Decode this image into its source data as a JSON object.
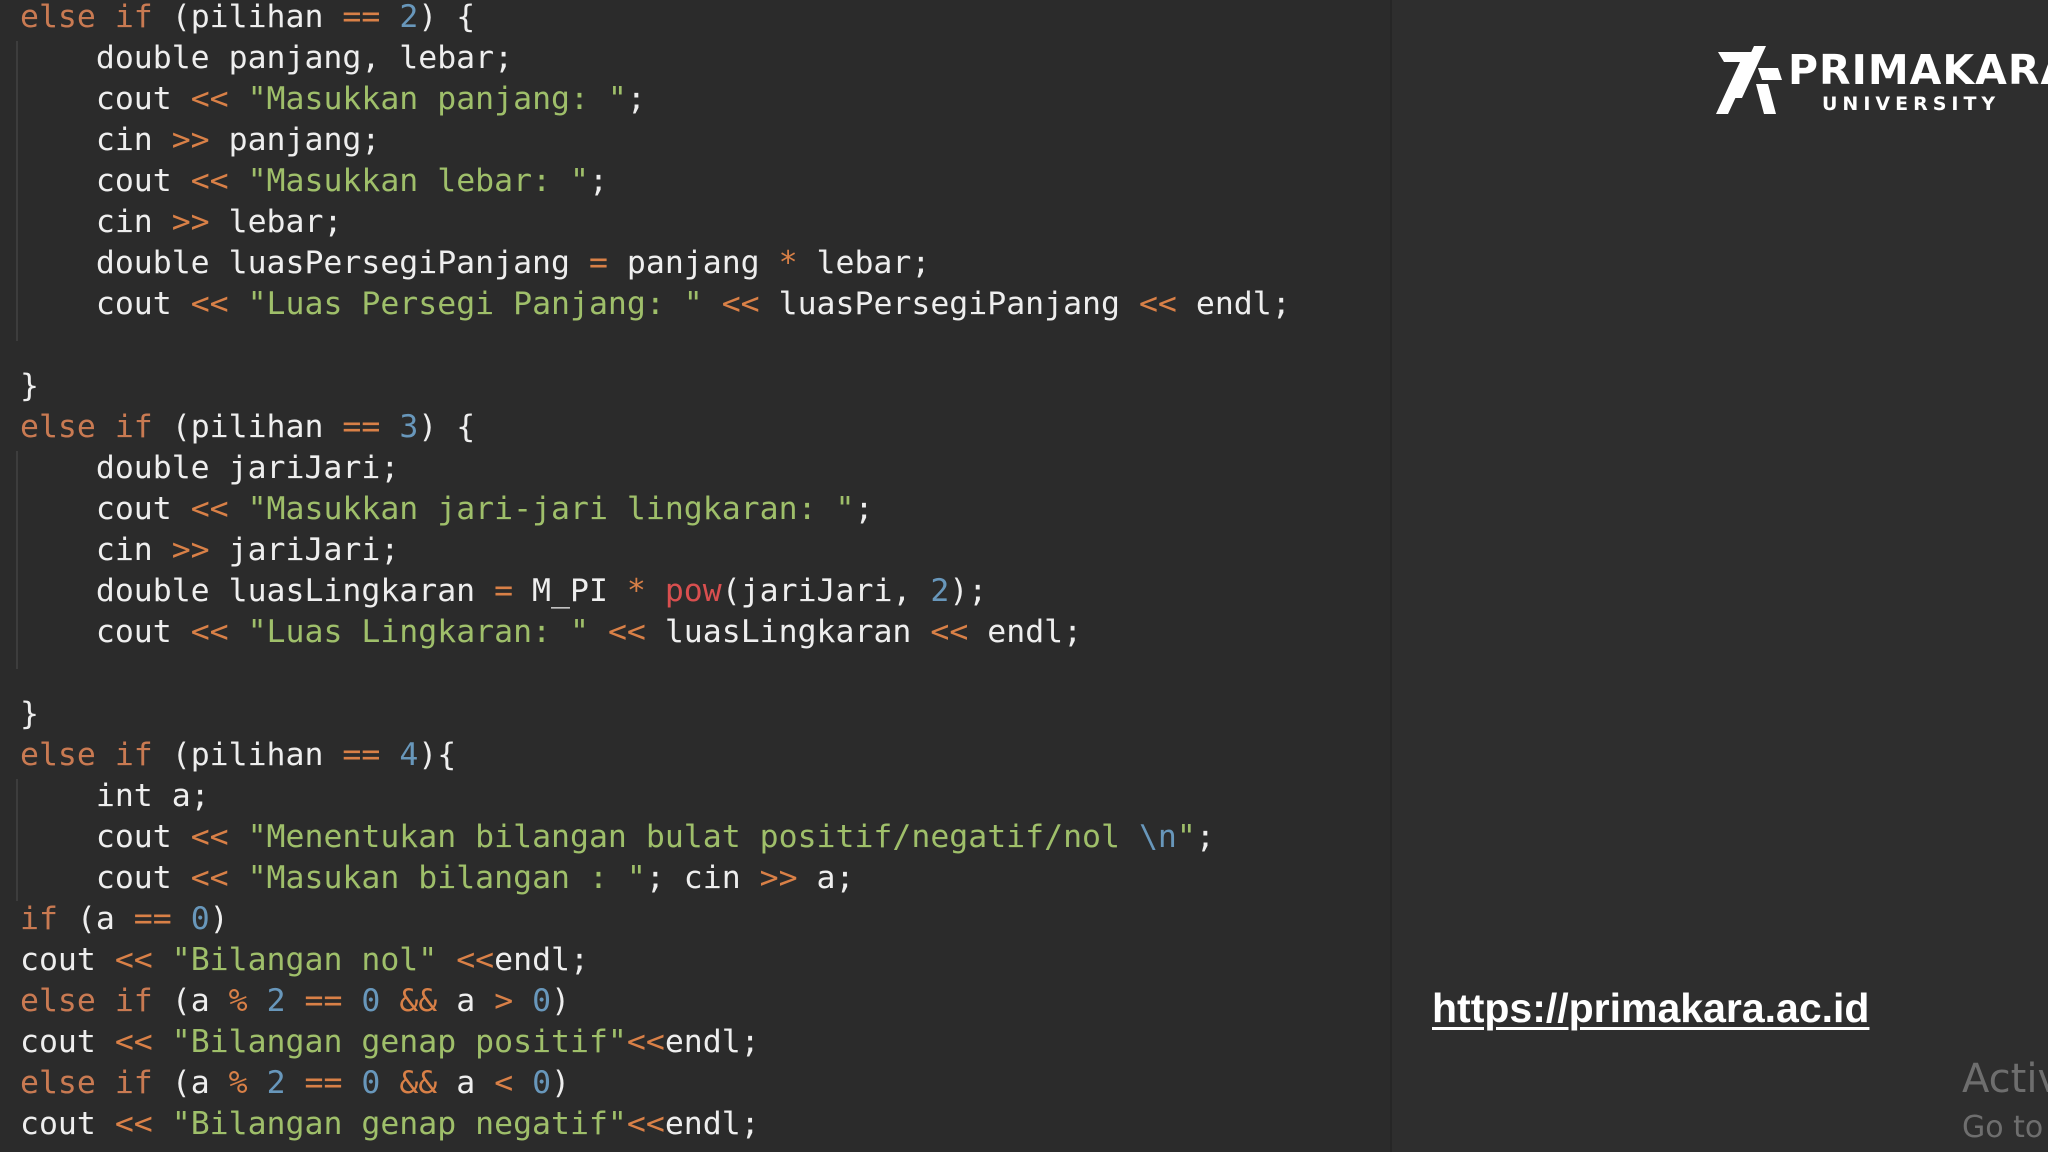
{
  "code": {
    "lines": [
      [
        [
          "kw",
          "else if"
        ],
        [
          "pl",
          " (pilihan "
        ],
        [
          "op",
          "=="
        ],
        [
          "pl",
          " "
        ],
        [
          "num",
          "2"
        ],
        [
          "pl",
          ") {"
        ]
      ],
      [
        [
          "pl",
          "    double panjang, lebar;"
        ]
      ],
      [
        [
          "pl",
          "    cout "
        ],
        [
          "op",
          "<<"
        ],
        [
          "pl",
          " "
        ],
        [
          "str",
          "\"Masukkan panjang: \""
        ],
        [
          "pl",
          ";"
        ]
      ],
      [
        [
          "pl",
          "    cin "
        ],
        [
          "op",
          ">>"
        ],
        [
          "pl",
          " panjang;"
        ]
      ],
      [
        [
          "pl",
          "    cout "
        ],
        [
          "op",
          "<<"
        ],
        [
          "pl",
          " "
        ],
        [
          "str",
          "\"Masukkan lebar: \""
        ],
        [
          "pl",
          ";"
        ]
      ],
      [
        [
          "pl",
          "    cin "
        ],
        [
          "op",
          ">>"
        ],
        [
          "pl",
          " lebar;"
        ]
      ],
      [
        [
          "pl",
          "    double luasPersegiPanjang "
        ],
        [
          "op",
          "="
        ],
        [
          "pl",
          " panjang "
        ],
        [
          "op",
          "*"
        ],
        [
          "pl",
          " lebar;"
        ]
      ],
      [
        [
          "pl",
          "    cout "
        ],
        [
          "op",
          "<<"
        ],
        [
          "pl",
          " "
        ],
        [
          "str",
          "\"Luas Persegi Panjang: \""
        ],
        [
          "pl",
          " "
        ],
        [
          "op",
          "<<"
        ],
        [
          "pl",
          " luasPersegiPanjang "
        ],
        [
          "op",
          "<<"
        ],
        [
          "pl",
          " endl;"
        ]
      ],
      [],
      [
        [
          "pl",
          "}"
        ]
      ],
      [
        [
          "kw",
          "else if"
        ],
        [
          "pl",
          " (pilihan "
        ],
        [
          "op",
          "=="
        ],
        [
          "pl",
          " "
        ],
        [
          "num",
          "3"
        ],
        [
          "pl",
          ") {"
        ]
      ],
      [
        [
          "pl",
          "    double jariJari;"
        ]
      ],
      [
        [
          "pl",
          "    cout "
        ],
        [
          "op",
          "<<"
        ],
        [
          "pl",
          " "
        ],
        [
          "str",
          "\"Masukkan jari-jari lingkaran: \""
        ],
        [
          "pl",
          ";"
        ]
      ],
      [
        [
          "pl",
          "    cin "
        ],
        [
          "op",
          ">>"
        ],
        [
          "pl",
          " jariJari;"
        ]
      ],
      [
        [
          "pl",
          "    double luasLingkaran "
        ],
        [
          "op",
          "="
        ],
        [
          "pl",
          " M_PI "
        ],
        [
          "op",
          "*"
        ],
        [
          "pl",
          " "
        ],
        [
          "fn",
          "pow"
        ],
        [
          "pl",
          "(jariJari, "
        ],
        [
          "num",
          "2"
        ],
        [
          "pl",
          ");"
        ]
      ],
      [
        [
          "pl",
          "    cout "
        ],
        [
          "op",
          "<<"
        ],
        [
          "pl",
          " "
        ],
        [
          "str",
          "\"Luas Lingkaran: \""
        ],
        [
          "pl",
          " "
        ],
        [
          "op",
          "<<"
        ],
        [
          "pl",
          " luasLingkaran "
        ],
        [
          "op",
          "<<"
        ],
        [
          "pl",
          " endl;"
        ]
      ],
      [],
      [
        [
          "pl",
          "}"
        ]
      ],
      [
        [
          "kw",
          "else if"
        ],
        [
          "pl",
          " (pilihan "
        ],
        [
          "op",
          "=="
        ],
        [
          "pl",
          " "
        ],
        [
          "num",
          "4"
        ],
        [
          "pl",
          "){"
        ]
      ],
      [
        [
          "pl",
          "    int a;"
        ]
      ],
      [
        [
          "pl",
          "    cout "
        ],
        [
          "op",
          "<<"
        ],
        [
          "pl",
          " "
        ],
        [
          "str",
          "\"Menentukan bilangan bulat positif/negatif/nol "
        ],
        [
          "num",
          "\\n"
        ],
        [
          "str",
          "\""
        ],
        [
          "pl",
          ";"
        ]
      ],
      [
        [
          "pl",
          "    cout "
        ],
        [
          "op",
          "<<"
        ],
        [
          "pl",
          " "
        ],
        [
          "str",
          "\"Masukan bilangan : \""
        ],
        [
          "pl",
          "; cin "
        ],
        [
          "op",
          ">>"
        ],
        [
          "pl",
          " a;"
        ]
      ],
      [
        [
          "kw",
          "if"
        ],
        [
          "pl",
          " (a "
        ],
        [
          "op",
          "=="
        ],
        [
          "pl",
          " "
        ],
        [
          "num",
          "0"
        ],
        [
          "pl",
          ")"
        ]
      ],
      [
        [
          "pl",
          "cout "
        ],
        [
          "op",
          "<<"
        ],
        [
          "pl",
          " "
        ],
        [
          "str",
          "\"Bilangan nol\""
        ],
        [
          "pl",
          " "
        ],
        [
          "op",
          "<<"
        ],
        [
          "pl",
          "endl;"
        ]
      ],
      [
        [
          "kw",
          "else if"
        ],
        [
          "pl",
          " (a "
        ],
        [
          "op",
          "%"
        ],
        [
          "pl",
          " "
        ],
        [
          "num",
          "2"
        ],
        [
          "pl",
          " "
        ],
        [
          "op",
          "=="
        ],
        [
          "pl",
          " "
        ],
        [
          "num",
          "0"
        ],
        [
          "pl",
          " "
        ],
        [
          "op",
          "&&"
        ],
        [
          "pl",
          " a "
        ],
        [
          "op",
          ">"
        ],
        [
          "pl",
          " "
        ],
        [
          "num",
          "0"
        ],
        [
          "pl",
          ")"
        ]
      ],
      [
        [
          "pl",
          "cout "
        ],
        [
          "op",
          "<<"
        ],
        [
          "pl",
          " "
        ],
        [
          "str",
          "\"Bilangan genap positif\""
        ],
        [
          "op",
          "<<"
        ],
        [
          "pl",
          "endl;"
        ]
      ],
      [
        [
          "kw",
          "else if"
        ],
        [
          "pl",
          " (a "
        ],
        [
          "op",
          "%"
        ],
        [
          "pl",
          " "
        ],
        [
          "num",
          "2"
        ],
        [
          "pl",
          " "
        ],
        [
          "op",
          "=="
        ],
        [
          "pl",
          " "
        ],
        [
          "num",
          "0"
        ],
        [
          "pl",
          " "
        ],
        [
          "op",
          "&&"
        ],
        [
          "pl",
          " a "
        ],
        [
          "op",
          "<"
        ],
        [
          "pl",
          " "
        ],
        [
          "num",
          "0"
        ],
        [
          "pl",
          ")"
        ]
      ],
      [
        [
          "pl",
          "cout "
        ],
        [
          "op",
          "<<"
        ],
        [
          "pl",
          " "
        ],
        [
          "str",
          "\"Bilangan genap negatif\""
        ],
        [
          "op",
          "<<"
        ],
        [
          "pl",
          "endl;"
        ]
      ]
    ]
  },
  "logo": {
    "name": "PRIMAKARA",
    "subtitle": "UNIVERSITY"
  },
  "link": {
    "url_text": "https://primakara.ac.id"
  },
  "watermark": {
    "line1": "Activ",
    "line2": "Go to"
  },
  "colors": {
    "background": "#2b2b2b",
    "keyword": "#c97a52",
    "operator": "#d98047",
    "string": "#9fbf6a",
    "number": "#6897bb",
    "function": "#d94f4f",
    "plain": "#eeeeee"
  }
}
